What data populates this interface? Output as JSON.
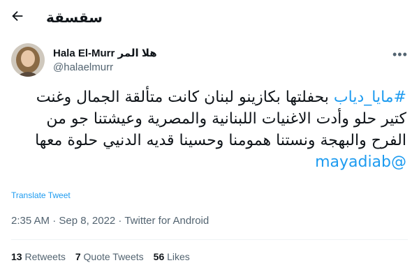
{
  "header": {
    "title": "سقسقة"
  },
  "author": {
    "name": "Hala El-Murr هلا المر",
    "handle": "@halaelmurr"
  },
  "tweet": {
    "hashtag": "#مايا_دياب",
    "text": " بحفلتها بكازينو لبنان كانت متألقة الجمال وغنت كتير حلو وأدت الاغنيات اللبنانية والمصرية وعيشتنا جو من الفرح والبهجة ونستنا همومنا وحسينا قديه الدنيي حلوة معها",
    "mention": "@mayadiab"
  },
  "translate_label": "Translate Tweet",
  "meta": {
    "timestamp": "2:35 AM · Sep 8, 2022 · ",
    "source": "Twitter for Android"
  },
  "stats": {
    "retweets_count": "13",
    "retweets_label": "Retweets",
    "quotes_count": "7",
    "quotes_label": "Quote Tweets",
    "likes_count": "56",
    "likes_label": "Likes"
  }
}
